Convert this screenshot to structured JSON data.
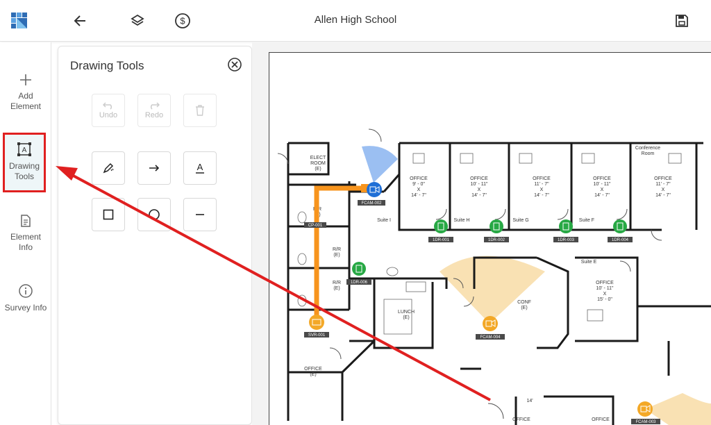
{
  "header": {
    "title": "Allen High School",
    "logo_icon": "app-logo-icon",
    "back_icon": "arrow-left-icon",
    "layers_icon": "layers-icon",
    "cost_icon": "dollar-circle-icon",
    "save_icon": "floppy-disk-icon"
  },
  "sidebar": {
    "items": [
      {
        "label_line1": "Add",
        "label_line2": "Element",
        "icon": "plus-icon"
      },
      {
        "label_line1": "Drawing",
        "label_line2": "Tools",
        "icon": "text-frame-icon",
        "active": true
      },
      {
        "label_line1": "Element",
        "label_line2": "Info",
        "icon": "document-icon"
      },
      {
        "label_line1": "Survey Info",
        "icon": "info-circle-icon"
      }
    ]
  },
  "drawing_panel": {
    "title": "Drawing Tools",
    "undo_label": "Undo",
    "redo_label": "Redo",
    "tools": [
      "pen-sparkle-icon",
      "arrow-right-icon",
      "text-underline-icon",
      "square-icon",
      "circle-icon",
      "line-icon"
    ]
  },
  "floorplan": {
    "rooms": {
      "elect": [
        "ELECT",
        "ROOM",
        "(E)"
      ],
      "rr": [
        "R/R",
        "(E)"
      ],
      "office1": [
        "OFFICE",
        "9' - 0\"",
        "X",
        "14' - 7\""
      ],
      "office2": [
        "OFFICE",
        "10' - 11\"",
        "X",
        "14' - 7\""
      ],
      "office3": [
        "OFFICE",
        "11' - 7\"",
        "X",
        "14' - 7\""
      ],
      "office4": [
        "OFFICE",
        "10' - 11\"",
        "X",
        "14' - 7\""
      ],
      "office5": [
        "OFFICE",
        "11' - 7\"",
        "X",
        "14' - 7\""
      ],
      "conference": [
        "Conference",
        "Room"
      ],
      "office6": [
        "OFFICE",
        "10' - 11\"",
        "X",
        "15' - 0\""
      ],
      "lunch": [
        "LUNCH",
        "(E)"
      ],
      "conf": [
        "CONF",
        "(E)"
      ],
      "office_e": [
        "OFFICE",
        "(E)"
      ],
      "suite_i": "Suite I",
      "suite_h": "Suite H",
      "suite_g": "Suite G",
      "suite_f": "Suite F",
      "suite_e": "Suite E",
      "office_b1": "OFFICE",
      "office_b2": "OFFICE",
      "dim_14": "14'"
    },
    "devices": {
      "fcam002": "FCAM-002",
      "fcam004": "FCAM-004",
      "fcam003": "FCAM-003",
      "cp001": "CP-001",
      "svr001": "SVR-001",
      "tdr001": "1DR-001",
      "tdr002": "1DR-002",
      "tdr003": "1DR-003",
      "tdr004": "1DR-004",
      "tdr006": "1DR-006"
    }
  },
  "colors": {
    "accent": "#2f6db5",
    "annotation_red": "#e02020",
    "cable_orange": "#f7941d",
    "camera_blue": "#1f6fd6",
    "camera_orange": "#f3a827",
    "door_green": "#27a844"
  }
}
